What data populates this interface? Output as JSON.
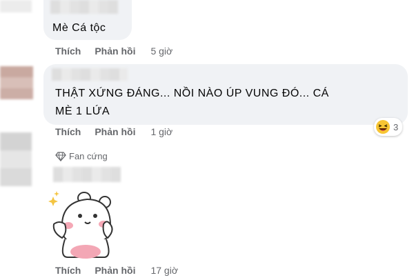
{
  "comments": [
    {
      "text": "Mè Cá tộc",
      "actions": {
        "like": "Thích",
        "reply": "Phản hồi",
        "time": "5 giờ"
      }
    },
    {
      "text_line1": "THẬT XỨNG ĐÁNG... NỒI NÀO ÚP VUNG ĐÓ... CÁ",
      "text_line2": "MÈ 1 LỨA",
      "reaction": {
        "icon": "laughing-emoji-icon",
        "count": "3"
      },
      "actions": {
        "like": "Thích",
        "reply": "Phản hồi",
        "time": "1 giờ"
      }
    },
    {
      "badge": {
        "icon": "diamond-icon",
        "label": "Fan cứng"
      },
      "sticker": "bear-sticker",
      "actions": {
        "like": "Thích",
        "reply": "Phản hồi",
        "time": "17 giờ"
      }
    }
  ],
  "colors": {
    "bubble": "#f0f2f5",
    "secondary_text": "#65676b",
    "primary_text": "#050505",
    "badge_blue": "#1877f2"
  }
}
